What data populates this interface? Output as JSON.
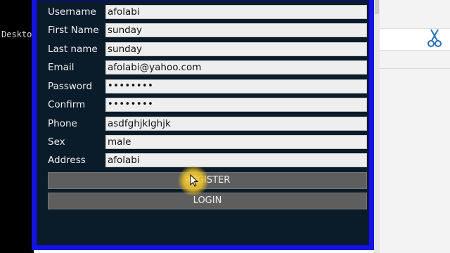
{
  "background": {
    "terminal_text": "Deskto"
  },
  "form": {
    "fields": [
      {
        "label": "Username",
        "value": "afolabi"
      },
      {
        "label": "First Name",
        "value": "sunday"
      },
      {
        "label": "Last name",
        "value": "sunday"
      },
      {
        "label": "Email",
        "value": "afolabi@yahoo.com"
      },
      {
        "label": "Password",
        "value": "••••••••"
      },
      {
        "label": "Confirm",
        "value": "••••••••"
      },
      {
        "label": "Phone",
        "value": "asdfghjklghjk"
      },
      {
        "label": "Sex",
        "value": "male"
      },
      {
        "label": "Address",
        "value": "afolabi"
      }
    ],
    "register_label": "REGISTER",
    "login_label": "LOGIN"
  },
  "colors": {
    "window_border": "#1414e0",
    "window_bg": "#0a1b2a",
    "button_bg": "#5e5e5e",
    "cursor_highlight": "#ebbe28"
  },
  "icons": {
    "right_toolbar": "scissors-icon",
    "pointer": "mouse-cursor-icon"
  }
}
